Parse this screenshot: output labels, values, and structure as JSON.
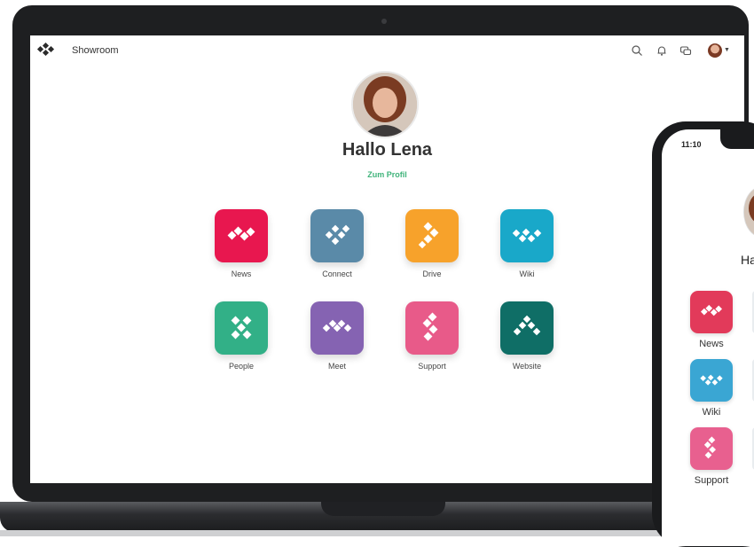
{
  "app": {
    "title": "Showroom"
  },
  "topbar": {
    "icons": [
      "search-icon",
      "bell-icon",
      "chat-icon"
    ],
    "avatar": "user-avatar"
  },
  "profile": {
    "greeting": "Hallo Lena",
    "link": "Zum Profil"
  },
  "apps": [
    {
      "label": "News",
      "color": "#e8174f",
      "icon": "news-icon"
    },
    {
      "label": "Connect",
      "color": "#5a8aa8",
      "icon": "connect-icon"
    },
    {
      "label": "Drive",
      "color": "#f7a22b",
      "icon": "drive-icon"
    },
    {
      "label": "Wiki",
      "color": "#19a8c9",
      "icon": "wiki-icon"
    },
    {
      "label": "People",
      "color": "#32b087",
      "icon": "people-icon"
    },
    {
      "label": "Meet",
      "color": "#8563b2",
      "icon": "meet-icon"
    },
    {
      "label": "Support",
      "color": "#e85a89",
      "icon": "support-icon"
    },
    {
      "label": "Website",
      "color": "#0f6e66",
      "icon": "website-icon"
    }
  ],
  "phone": {
    "time": "11:10",
    "greeting_partial": "Ha",
    "apps": [
      {
        "label": "News",
        "color": "#e23a5a"
      },
      {
        "label": "Wiki",
        "color": "#3aa6d3"
      },
      {
        "label": "Support",
        "color": "#e8608f"
      }
    ]
  }
}
